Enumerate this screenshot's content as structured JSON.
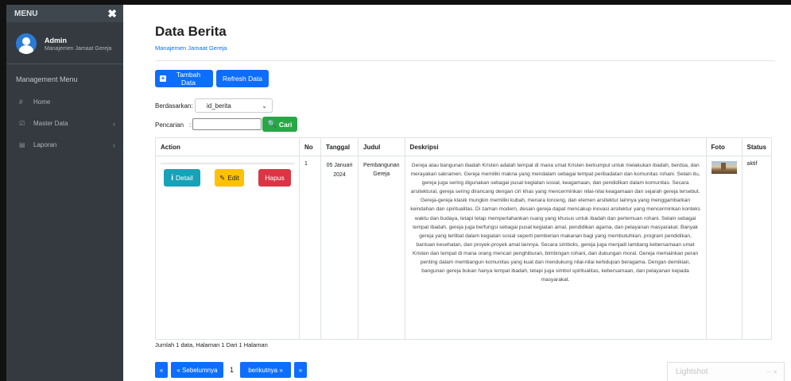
{
  "sidebar": {
    "menu_label": "MENU",
    "close_glyph": "✖",
    "user": {
      "name": "Admin",
      "role": "Manajemen Jamaat Gereja"
    },
    "section_title": "Management Menu",
    "items": [
      {
        "label": "Home",
        "icon": "#",
        "icon_name": "home-icon",
        "has_submenu": false
      },
      {
        "label": "Master Data",
        "icon": "☑",
        "icon_name": "edit-icon",
        "has_submenu": true
      },
      {
        "label": "Laporan",
        "icon": "▤",
        "icon_name": "report-icon",
        "has_submenu": true
      }
    ],
    "chevron": "›"
  },
  "header": {
    "title": "Data Berita",
    "subtitle": "Manajemen Jamaat Gereja"
  },
  "toolbar": {
    "add_label": "Tambah Data",
    "refresh_label": "Refresh Data"
  },
  "filter": {
    "sort_label": "Berdasarkan:",
    "sort_value": "id_berita",
    "search_label": "Pencarian",
    "search_sep": ":",
    "search_value": "",
    "search_button": "Cari"
  },
  "table": {
    "columns": [
      "Action",
      "No",
      "Tanggal",
      "Judul",
      "Deskripsi",
      "Foto",
      "Status"
    ],
    "rows": [
      {
        "actions": {
          "detail": "Detail",
          "edit": "Edit",
          "delete": "Hapus"
        },
        "no": "1",
        "tanggal": "05 Januari 2024",
        "judul": "Pembangunan Gereja",
        "deskripsi": "Gereja atau bangunan ibadah Kristen adalah tempat di mana umat Kristen berkumpul untuk melakukan ibadah, berdoa, dan merayakan sakramen. Gereja memiliki makna yang mendalam sebagai tempat peribadatan dan komunitas rohani. Selain itu, gereja juga sering digunakan sebagai pusat kegiatan sosial, keagamaan, dan pendidikan dalam komunitas. Secara arsitektural, gereja sering dirancang dengan ciri khas yang mencerminkan nilai-nilai keagamaan dan sejarah gereja tersebut. Gereja-gereja klasik mungkin memiliki kubah, menara lonceng, dan elemen arsitektur lainnya yang menggambarkan keindahan dan spiritualitas. Di zaman modern, desain gereja dapat mencakup inovasi arsitektur yang mencerminkan konteks waktu dan budaya, tetapi tetap mempertahankan ruang yang khusus untuk ibadah dan pertemuan rohani. Selain sebagai tempat ibadah, gereja juga berfungsi sebagai pusat kegiatan amal, pendidikan agama, dan pelayanan masyarakat. Banyak gereja yang terlibat dalam kegiatan sosial seperti pemberian makanan bagi yang membutuhkan, program pendidikan, bantuan kesehatan, dan proyek-proyek amal lainnya. Secara simbolis, gereja juga menjadi lambang kebersamaan umat Kristen dan tempat di mana orang mencari penghiburan, bimbingan rohani, dan dukungan moral. Gereja memainkan peran penting dalam membangun komunitas yang kuat dan mendukung nilai-nilai kehidupan beragama. Dengan demikian, bangunan gereja bukan hanya tempat ibadah, tetapi juga simbol spiritualitas, kebersamaan, dan pelayanan kepada masyarakat.",
        "foto_icon": "church-photo",
        "status": "aktif"
      }
    ]
  },
  "summary": "Jumlah 1 data, Halaman 1 Dari 1 Halaman",
  "pagination": {
    "first": "«",
    "prev": "« Sebelumnya",
    "current": "1",
    "next": "berikutnya »",
    "last": "»"
  },
  "overlay": {
    "title": "Lightshot",
    "controls": "ㅡ ✕"
  },
  "colors": {
    "primary": "#0d6efd",
    "success": "#28a745",
    "info": "#17a2b8",
    "warning": "#ffc107",
    "danger": "#dc3545",
    "sidebar": "#343a40"
  }
}
